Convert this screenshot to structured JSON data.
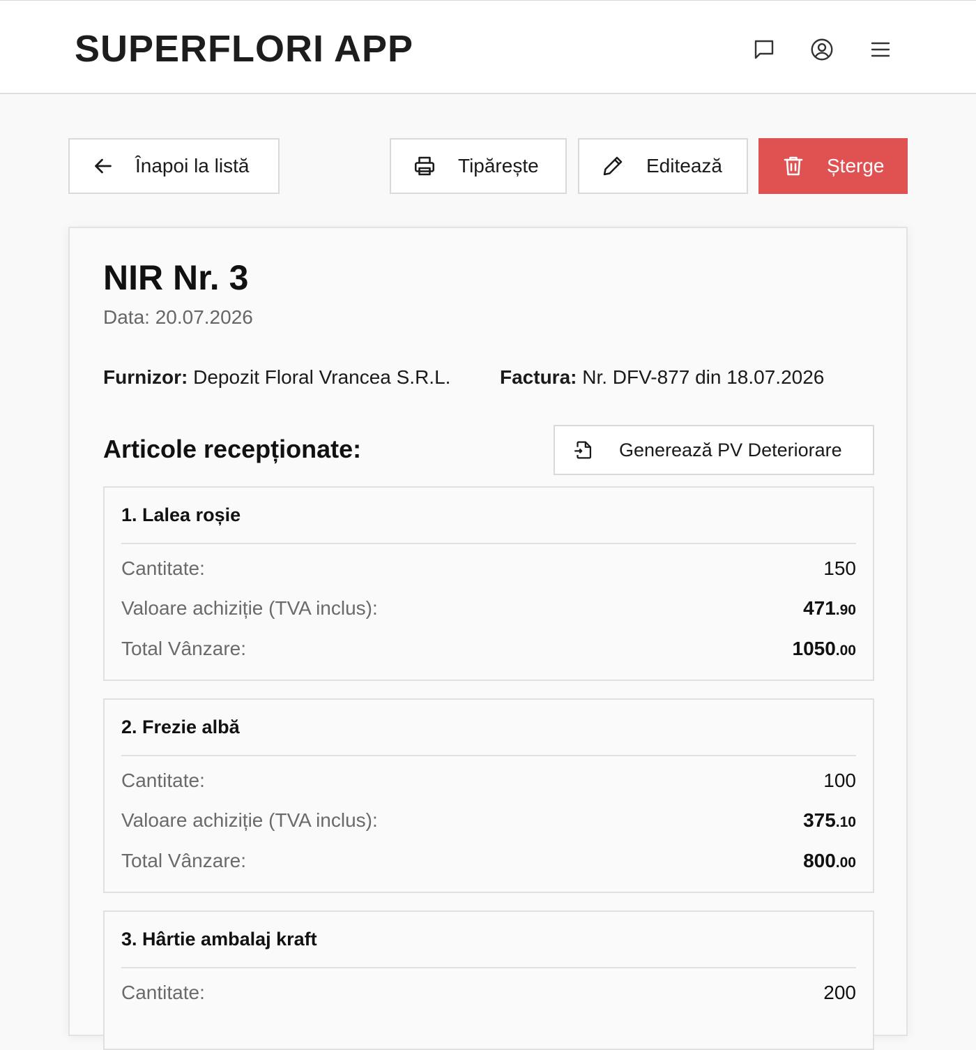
{
  "header": {
    "brand": "SUPERFLORI APP",
    "icons": [
      "chat-icon",
      "user-circle-icon",
      "menu-icon"
    ]
  },
  "toolbar": {
    "back_label": "Înapoi la listă",
    "print_label": "Tipărește",
    "edit_label": "Editează",
    "delete_label": "Șterge",
    "danger_color": "#e05252"
  },
  "document": {
    "title": "NIR Nr. 3",
    "date": "Data: 20.07.2026",
    "supplier_label": "Furnizor:",
    "supplier_value": "Depozit Floral Vrancea S.R.L.",
    "invoice_label": "Factura:",
    "invoice_value": "Nr. DFV-877 din 18.07.2026"
  },
  "section": {
    "title": "Articole recepționate:",
    "generate_label": "Generează PV Deteriorare"
  },
  "labels": {
    "quantity": "Cantitate:",
    "purchase": "Valoare achiziție (TVA inclus):",
    "sale": "Total Vânzare:"
  },
  "items": [
    {
      "title": "1. Lalea roșie",
      "quantity": "150",
      "purchase_int": "471",
      "purchase_dec": ".90",
      "sale_int": "1050",
      "sale_dec": ".00"
    },
    {
      "title": "2. Frezie albă",
      "quantity": "100",
      "purchase_int": "375",
      "purchase_dec": ".10",
      "sale_int": "800",
      "sale_dec": ".00"
    },
    {
      "title": "3. Hârtie ambalaj kraft",
      "quantity": "200"
    }
  ]
}
